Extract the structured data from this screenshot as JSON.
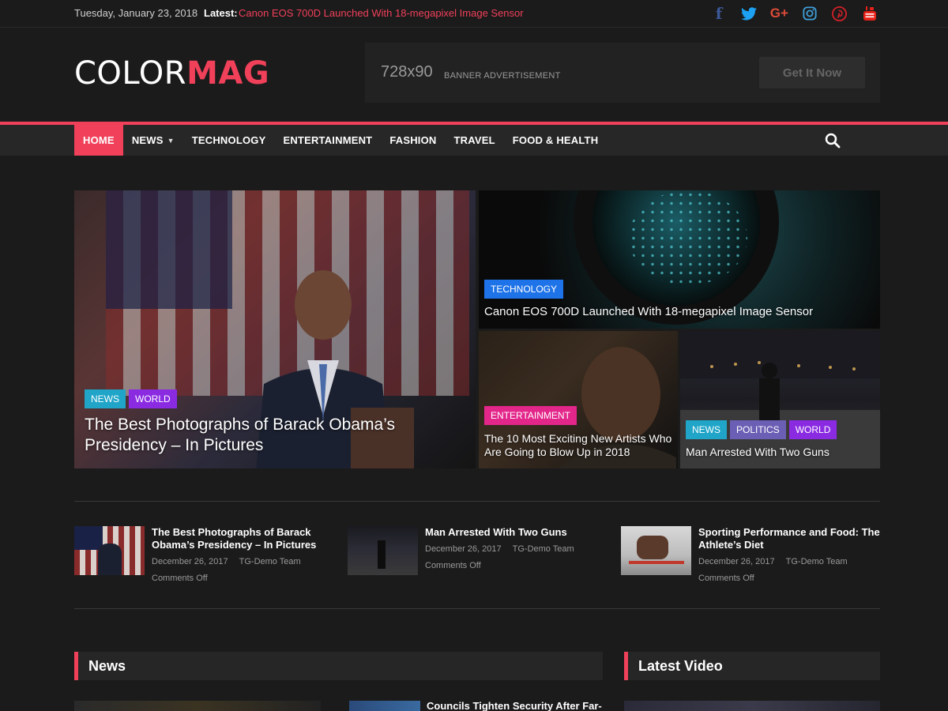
{
  "topbar": {
    "date": "Tuesday, January 23, 2018",
    "latest_label": "Latest:",
    "latest_headline": "Canon EOS 700D Launched With 18-megapixel Image Sensor"
  },
  "social": {
    "facebook": "f",
    "googleplus": "G+"
  },
  "header": {
    "logo_left": "COLOR",
    "logo_right": "MAG",
    "banner_size": "728x90",
    "banner_text": "BANNER ADVERTISEMENT",
    "banner_button": "Get It Now"
  },
  "nav": {
    "items": [
      "HOME",
      "NEWS",
      "TECHNOLOGY",
      "ENTERTAINMENT",
      "FASHION",
      "TRAVEL",
      "FOOD & HEALTH"
    ]
  },
  "featured": {
    "main": {
      "cats": [
        "NEWS",
        "WORLD"
      ],
      "title": "The Best Photographs of Barack Obama’s Presidency – In Pictures"
    },
    "right_top": {
      "cats": [
        "TECHNOLOGY"
      ],
      "title": "Canon EOS 700D Launched With 18-megapixel Image Sensor"
    },
    "right_mid": {
      "cats": [
        "ENTERTAINMENT"
      ],
      "title": "The 10 Most Exciting New Artists Who Are Going to Blow Up in 2018"
    },
    "right_end": {
      "cats": [
        "NEWS",
        "POLITICS",
        "WORLD"
      ],
      "title": "Man Arrested With Two Guns"
    }
  },
  "posts": [
    {
      "title": "The Best Photographs of Barack Obama’s Presidency – In Pictures",
      "date": "December 26, 2017",
      "author": "TG-Demo Team",
      "comments": "Comments Off"
    },
    {
      "title": "Man Arrested With Two Guns",
      "date": "December 26, 2017",
      "author": "TG-Demo Team",
      "comments": "Comments Off"
    },
    {
      "title": "Sporting Performance and Food: The Athlete’s Diet",
      "date": "December 26, 2017",
      "author": "TG-Demo Team",
      "comments": "Comments Off"
    }
  ],
  "sections": {
    "news": "News",
    "video": "Latest Video"
  },
  "bottom": {
    "partial_title": "Councils Tighten Security After Far-"
  },
  "colors": {
    "accent": "#f0405a",
    "background": "#1b1b1b"
  }
}
